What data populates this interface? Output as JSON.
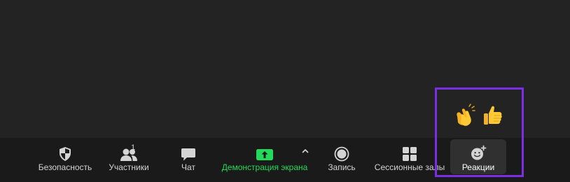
{
  "colors": {
    "background": "#232323",
    "toolbar_bg": "#1a1a1a",
    "label": "#d4d4d4",
    "share_green": "#23d959",
    "highlight": "#7b2ee6"
  },
  "toolbar": {
    "security": {
      "label": "Безопасность",
      "icon": "shield-icon"
    },
    "participants": {
      "label": "Участники",
      "icon": "participants-icon",
      "count": "1"
    },
    "chat": {
      "label": "Чат",
      "icon": "chat-bubble-icon"
    },
    "share_screen": {
      "label": "Демонстрация экрана",
      "icon": "share-screen-arrow-icon"
    },
    "record": {
      "label": "Запись",
      "icon": "record-icon"
    },
    "breakout": {
      "label": "Сессионные залы",
      "icon": "breakout-rooms-grid-icon"
    },
    "reactions": {
      "label": "Реакции",
      "icon": "smiley-plus-icon"
    }
  },
  "reaction_popup": {
    "items": [
      {
        "name": "clap",
        "icon": "clapping-hands-emoji"
      },
      {
        "name": "thumbs-up",
        "icon": "thumbs-up-emoji"
      }
    ]
  }
}
